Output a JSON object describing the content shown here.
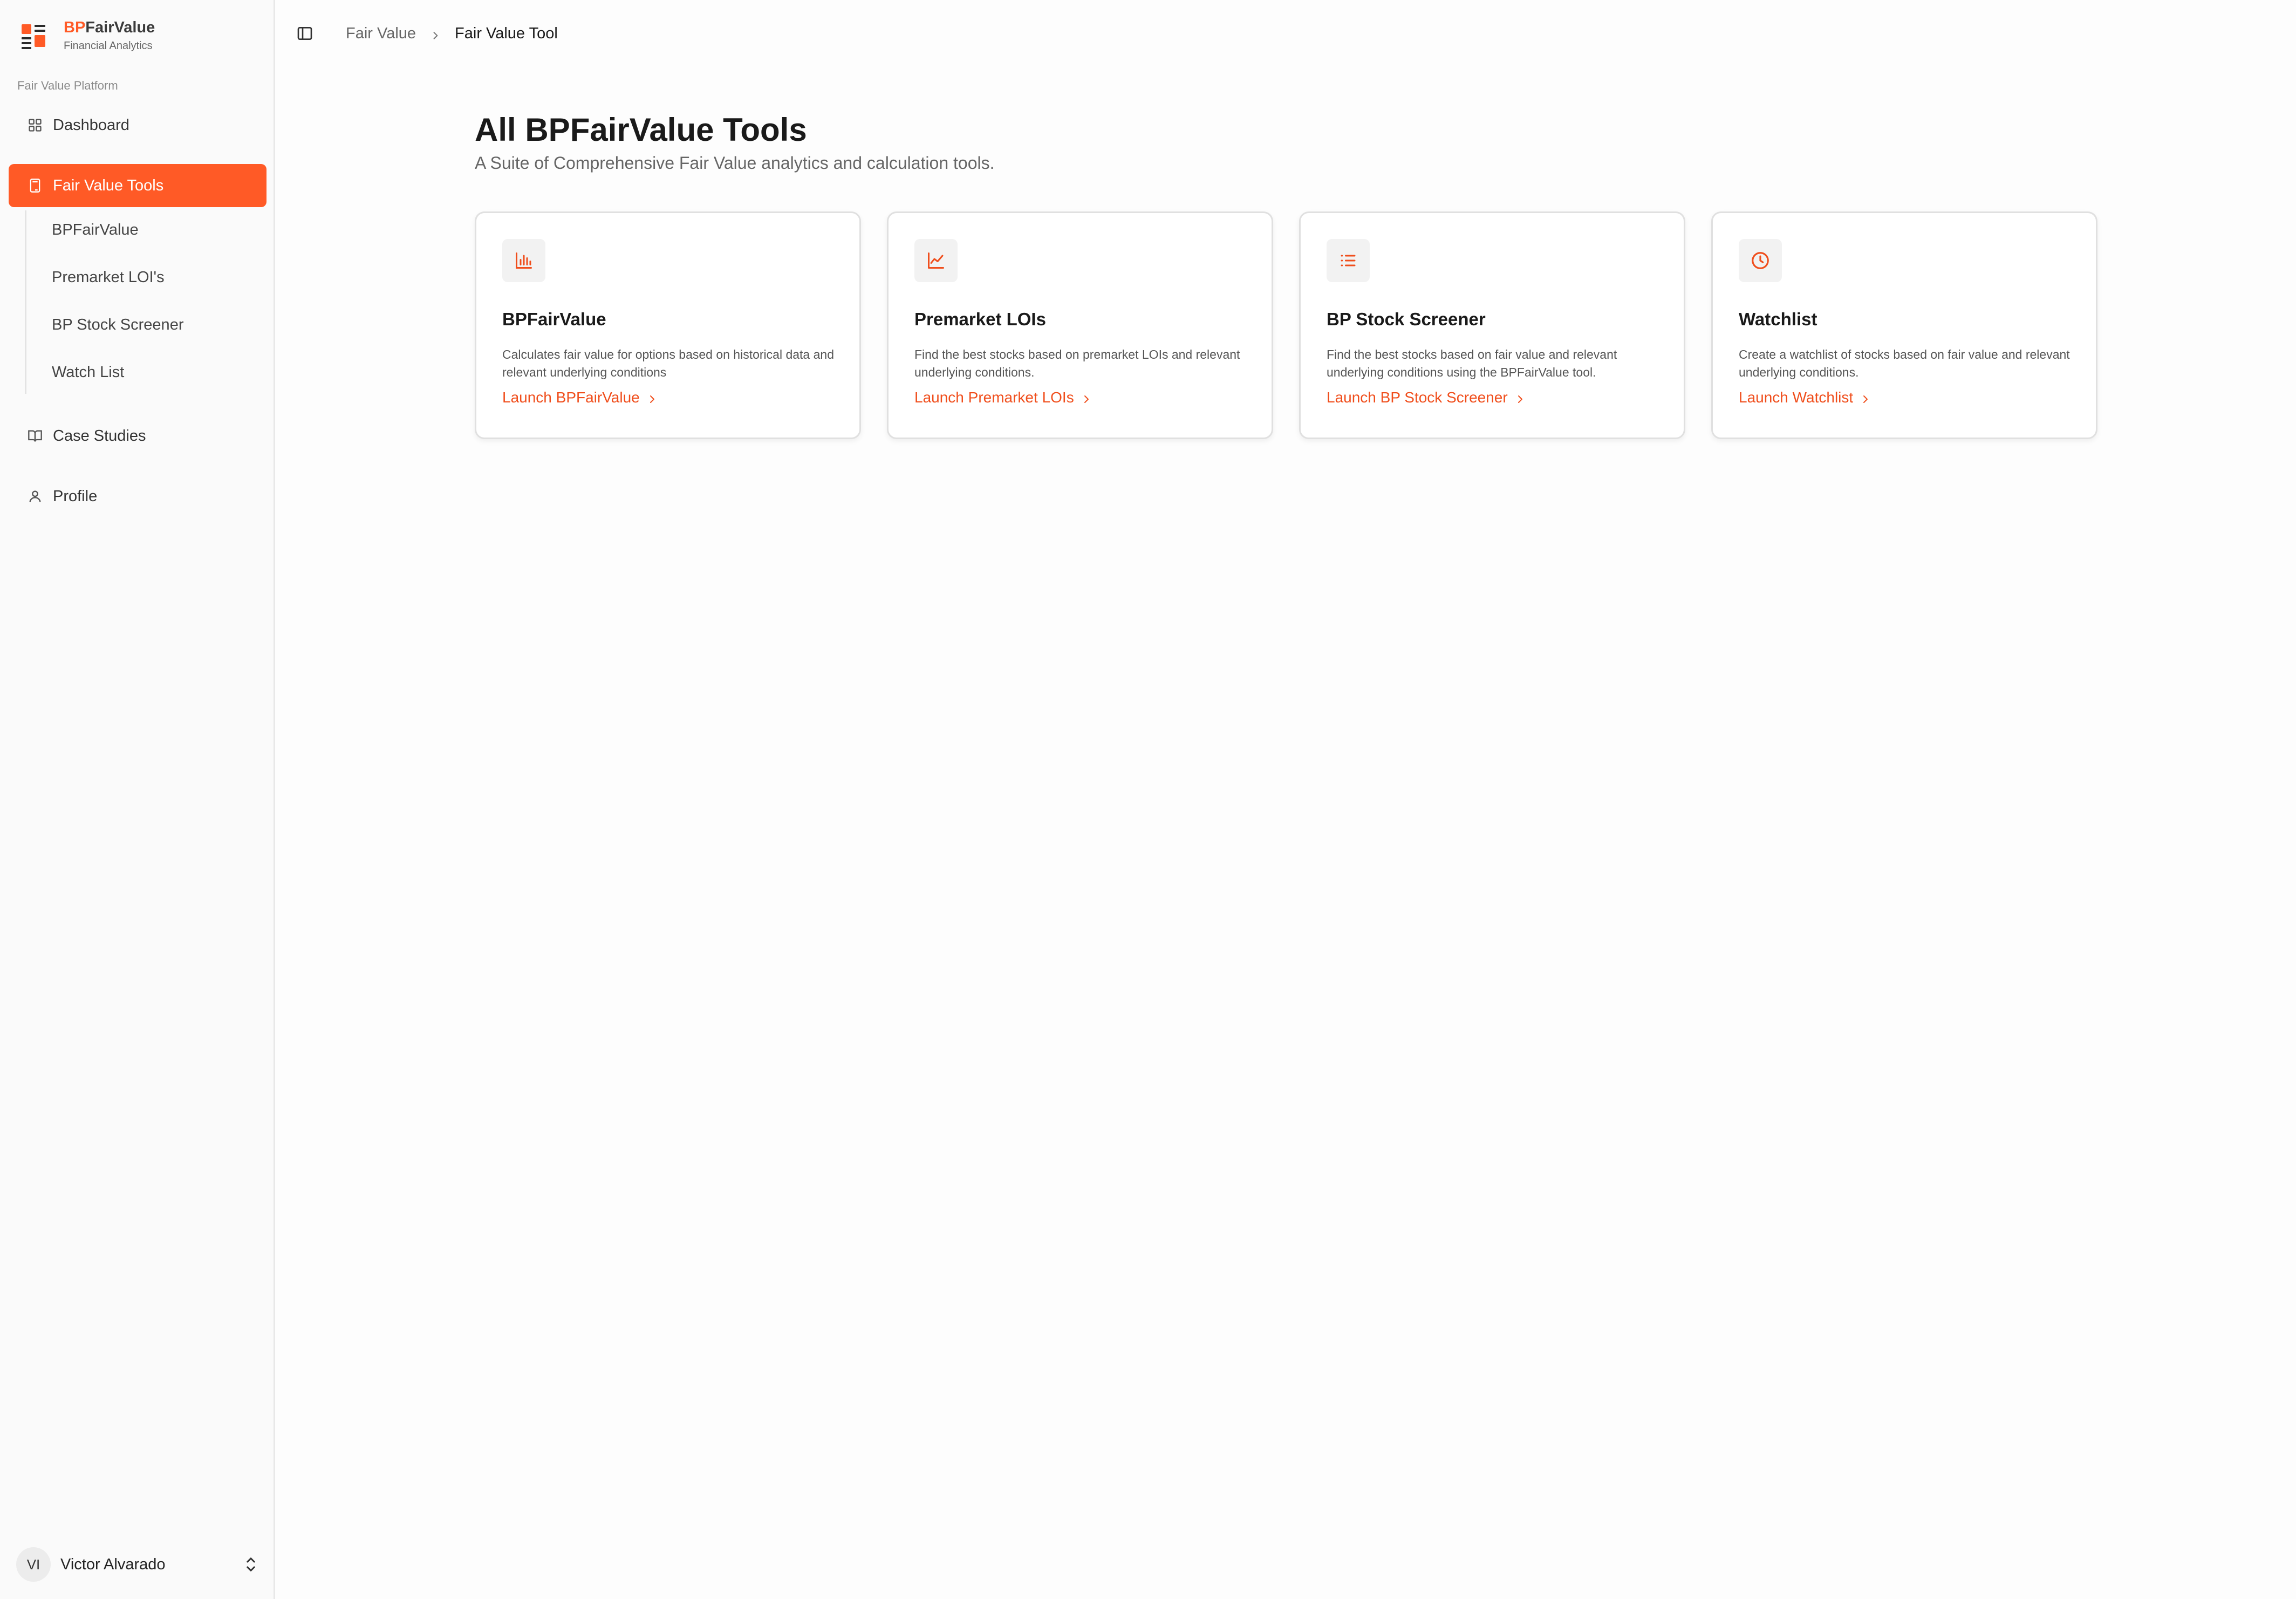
{
  "brand": {
    "prefix": "BP",
    "suffix": "FairValue",
    "subtitle": "Financial Analytics"
  },
  "sidebar": {
    "section_label": "Fair Value Platform",
    "items": [
      {
        "label": "Dashboard",
        "icon": "grid-icon"
      },
      {
        "label": "Fair Value Tools",
        "icon": "calculator-icon",
        "active": true
      },
      {
        "label": "Case Studies",
        "icon": "book-icon"
      },
      {
        "label": "Profile",
        "icon": "user-icon"
      }
    ],
    "subitems": [
      "BPFairValue",
      "Premarket LOI's",
      "BP Stock Screener",
      "Watch List"
    ]
  },
  "user": {
    "initials": "VI",
    "name": "Victor Alvarado"
  },
  "breadcrumb": {
    "parent": "Fair Value",
    "current": "Fair Value Tool"
  },
  "main": {
    "title": "All BPFairValue Tools",
    "subtitle": "A Suite of Comprehensive Fair Value analytics and calculation tools.",
    "cards": [
      {
        "icon": "bar-chart-icon",
        "title": "BPFairValue",
        "description": "Calculates fair value for options based on historical data and relevant underlying conditions",
        "link": "Launch BPFairValue"
      },
      {
        "icon": "line-chart-icon",
        "title": "Premarket LOIs",
        "description": "Find the best stocks based on premarket LOIs and relevant underlying conditions.",
        "link": "Launch Premarket LOIs"
      },
      {
        "icon": "list-icon",
        "title": "BP Stock Screener",
        "description": "Find the best stocks based on fair value and relevant underlying conditions using the BPFairValue tool.",
        "link": "Launch BP Stock Screener"
      },
      {
        "icon": "clock-icon",
        "title": "Watchlist",
        "description": "Create a watchlist of stocks based on fair value and relevant underlying conditions.",
        "link": "Launch Watchlist"
      }
    ]
  },
  "colors": {
    "accent": "#ff5a26",
    "link": "#f04e1c"
  }
}
